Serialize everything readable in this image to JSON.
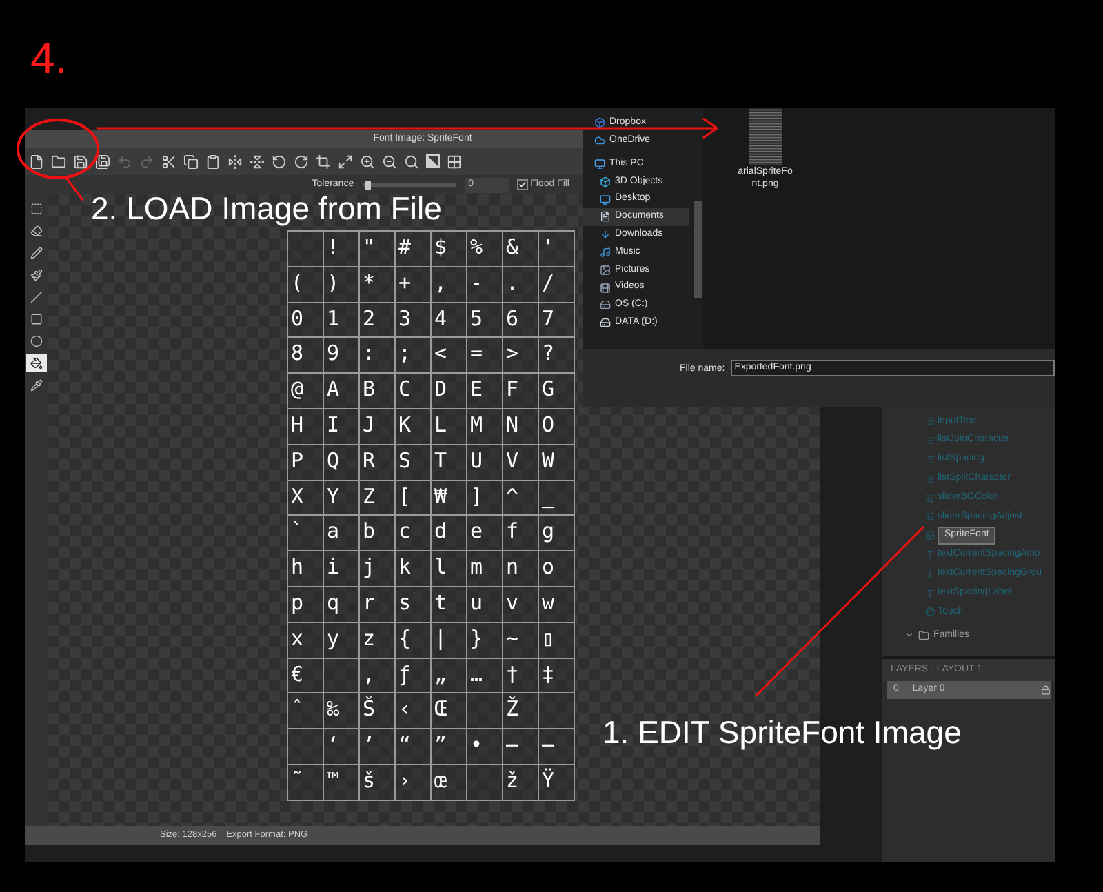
{
  "annotations": {
    "step": "4.",
    "callouts": [
      "2. LOAD Image from File",
      "1. EDIT SpriteFont Image"
    ]
  },
  "editor": {
    "title": "Font Image: SpriteFont",
    "toolbar": [
      {
        "kind": "new",
        "disabled": false
      },
      {
        "kind": "open",
        "disabled": false
      },
      {
        "kind": "save",
        "disabled": false
      },
      {
        "kind": "save-as",
        "disabled": false
      },
      {
        "kind": "undo",
        "disabled": true
      },
      {
        "kind": "redo",
        "disabled": true
      },
      {
        "kind": "cut",
        "disabled": false
      },
      {
        "kind": "copy",
        "disabled": false
      },
      {
        "kind": "paste",
        "disabled": false
      },
      {
        "kind": "flip-h",
        "disabled": false
      },
      {
        "kind": "flip-v",
        "disabled": false
      },
      {
        "kind": "rotate-ccw",
        "disabled": false
      },
      {
        "kind": "rotate-cw",
        "disabled": false
      },
      {
        "kind": "crop",
        "disabled": false
      },
      {
        "kind": "resize",
        "disabled": false
      },
      {
        "kind": "zoom-in",
        "disabled": false
      },
      {
        "kind": "zoom-out",
        "disabled": false
      },
      {
        "kind": "zoom-fit",
        "disabled": false
      },
      {
        "kind": "invert",
        "disabled": false
      },
      {
        "kind": "grid",
        "disabled": false
      }
    ],
    "tolerance": {
      "label": "Tolerance",
      "level": 0.03,
      "value": "0"
    },
    "flood_fill": {
      "label": "Flood Fill",
      "checked": true
    },
    "tools": [
      {
        "kind": "select",
        "selected": false
      },
      {
        "kind": "eraser",
        "selected": false
      },
      {
        "kind": "pencil",
        "selected": false
      },
      {
        "kind": "brush",
        "selected": false
      },
      {
        "kind": "line",
        "selected": false
      },
      {
        "kind": "rectangle",
        "selected": false
      },
      {
        "kind": "ellipse",
        "selected": false
      },
      {
        "kind": "fill",
        "selected": true
      },
      {
        "kind": "picker",
        "selected": false
      }
    ],
    "glyph_rows": [
      [
        null,
        "!",
        "\"",
        "#",
        "$",
        "%",
        "&",
        "'"
      ],
      [
        "(",
        ")",
        "*",
        "+",
        ",",
        "-",
        ".",
        "/"
      ],
      [
        "0",
        "1",
        "2",
        "3",
        "4",
        "5",
        "6",
        "7"
      ],
      [
        "8",
        "9",
        ":",
        ";",
        "<",
        "=",
        ">",
        "?"
      ],
      [
        "@",
        "A",
        "B",
        "C",
        "D",
        "E",
        "F",
        "G"
      ],
      [
        "H",
        "I",
        "J",
        "K",
        "L",
        "M",
        "N",
        "O"
      ],
      [
        "P",
        "Q",
        "R",
        "S",
        "T",
        "U",
        "V",
        "W"
      ],
      [
        "X",
        "Y",
        "Z",
        "[",
        "₩",
        "]",
        "^",
        "_"
      ],
      [
        "`",
        "a",
        "b",
        "c",
        "d",
        "e",
        "f",
        "g"
      ],
      [
        "h",
        "i",
        "j",
        "k",
        "l",
        "m",
        "n",
        "o"
      ],
      [
        "p",
        "q",
        "r",
        "s",
        "t",
        "u",
        "v",
        "w"
      ],
      [
        "x",
        "y",
        "z",
        "{",
        "|",
        "}",
        "~",
        "▯"
      ],
      [
        "€",
        null,
        "‚",
        "ƒ",
        "„",
        "…",
        "†",
        "‡"
      ],
      [
        "ˆ",
        "‰",
        "Š",
        "‹",
        "Œ",
        null,
        "Ž",
        null
      ],
      [
        null,
        "‘",
        "’",
        "“",
        "”",
        "•",
        "–",
        "—"
      ],
      [
        "˜",
        "™",
        "š",
        "›",
        "œ",
        null,
        "ž",
        "Ÿ"
      ]
    ],
    "status": {
      "size": "Size: 128x256",
      "format": "Export Format: PNG"
    }
  },
  "file_dialog": {
    "nav": [
      {
        "label": "Dropbox",
        "selected": false
      },
      {
        "label": "OneDrive",
        "selected": false
      },
      {
        "label": "This PC",
        "selected": false
      },
      {
        "label": "3D Objects",
        "selected": false
      },
      {
        "label": "Desktop",
        "selected": false
      },
      {
        "label": "Documents",
        "selected": true
      },
      {
        "label": "Downloads",
        "selected": false
      },
      {
        "label": "Music",
        "selected": false
      },
      {
        "label": "Pictures",
        "selected": false
      },
      {
        "label": "Videos",
        "selected": false
      },
      {
        "label": "OS (C:)",
        "selected": false
      },
      {
        "label": "DATA (D:)",
        "selected": false
      }
    ],
    "files": [
      {
        "name": "arialSpriteFont.png"
      }
    ],
    "file_name": {
      "label": "File name:",
      "value": "ExportedFont.png"
    }
  },
  "project_panel": {
    "items": [
      {
        "label": "inputText",
        "selected": false
      },
      {
        "label": "listJoinCharacter",
        "selected": false
      },
      {
        "label": "listSpacing",
        "selected": false
      },
      {
        "label": "listSplitCharacter",
        "selected": false
      },
      {
        "label": "sliderBGColor",
        "selected": false
      },
      {
        "label": "sliderSpacingAdjust",
        "selected": false
      },
      {
        "label": "SpriteFont",
        "selected": true
      },
      {
        "label": "textCurrentSpacingAmo",
        "selected": false
      },
      {
        "label": "textCurrentSpacingGrou",
        "selected": false
      },
      {
        "label": "textSpacingLabel",
        "selected": false
      },
      {
        "label": "Touch",
        "selected": false
      }
    ],
    "folders": [
      {
        "label": "Families",
        "expanded": true
      }
    ],
    "layers": {
      "title": "LAYERS - LAYOUT 1",
      "rows": [
        {
          "index": "0",
          "name": "Layer 0"
        }
      ]
    }
  }
}
